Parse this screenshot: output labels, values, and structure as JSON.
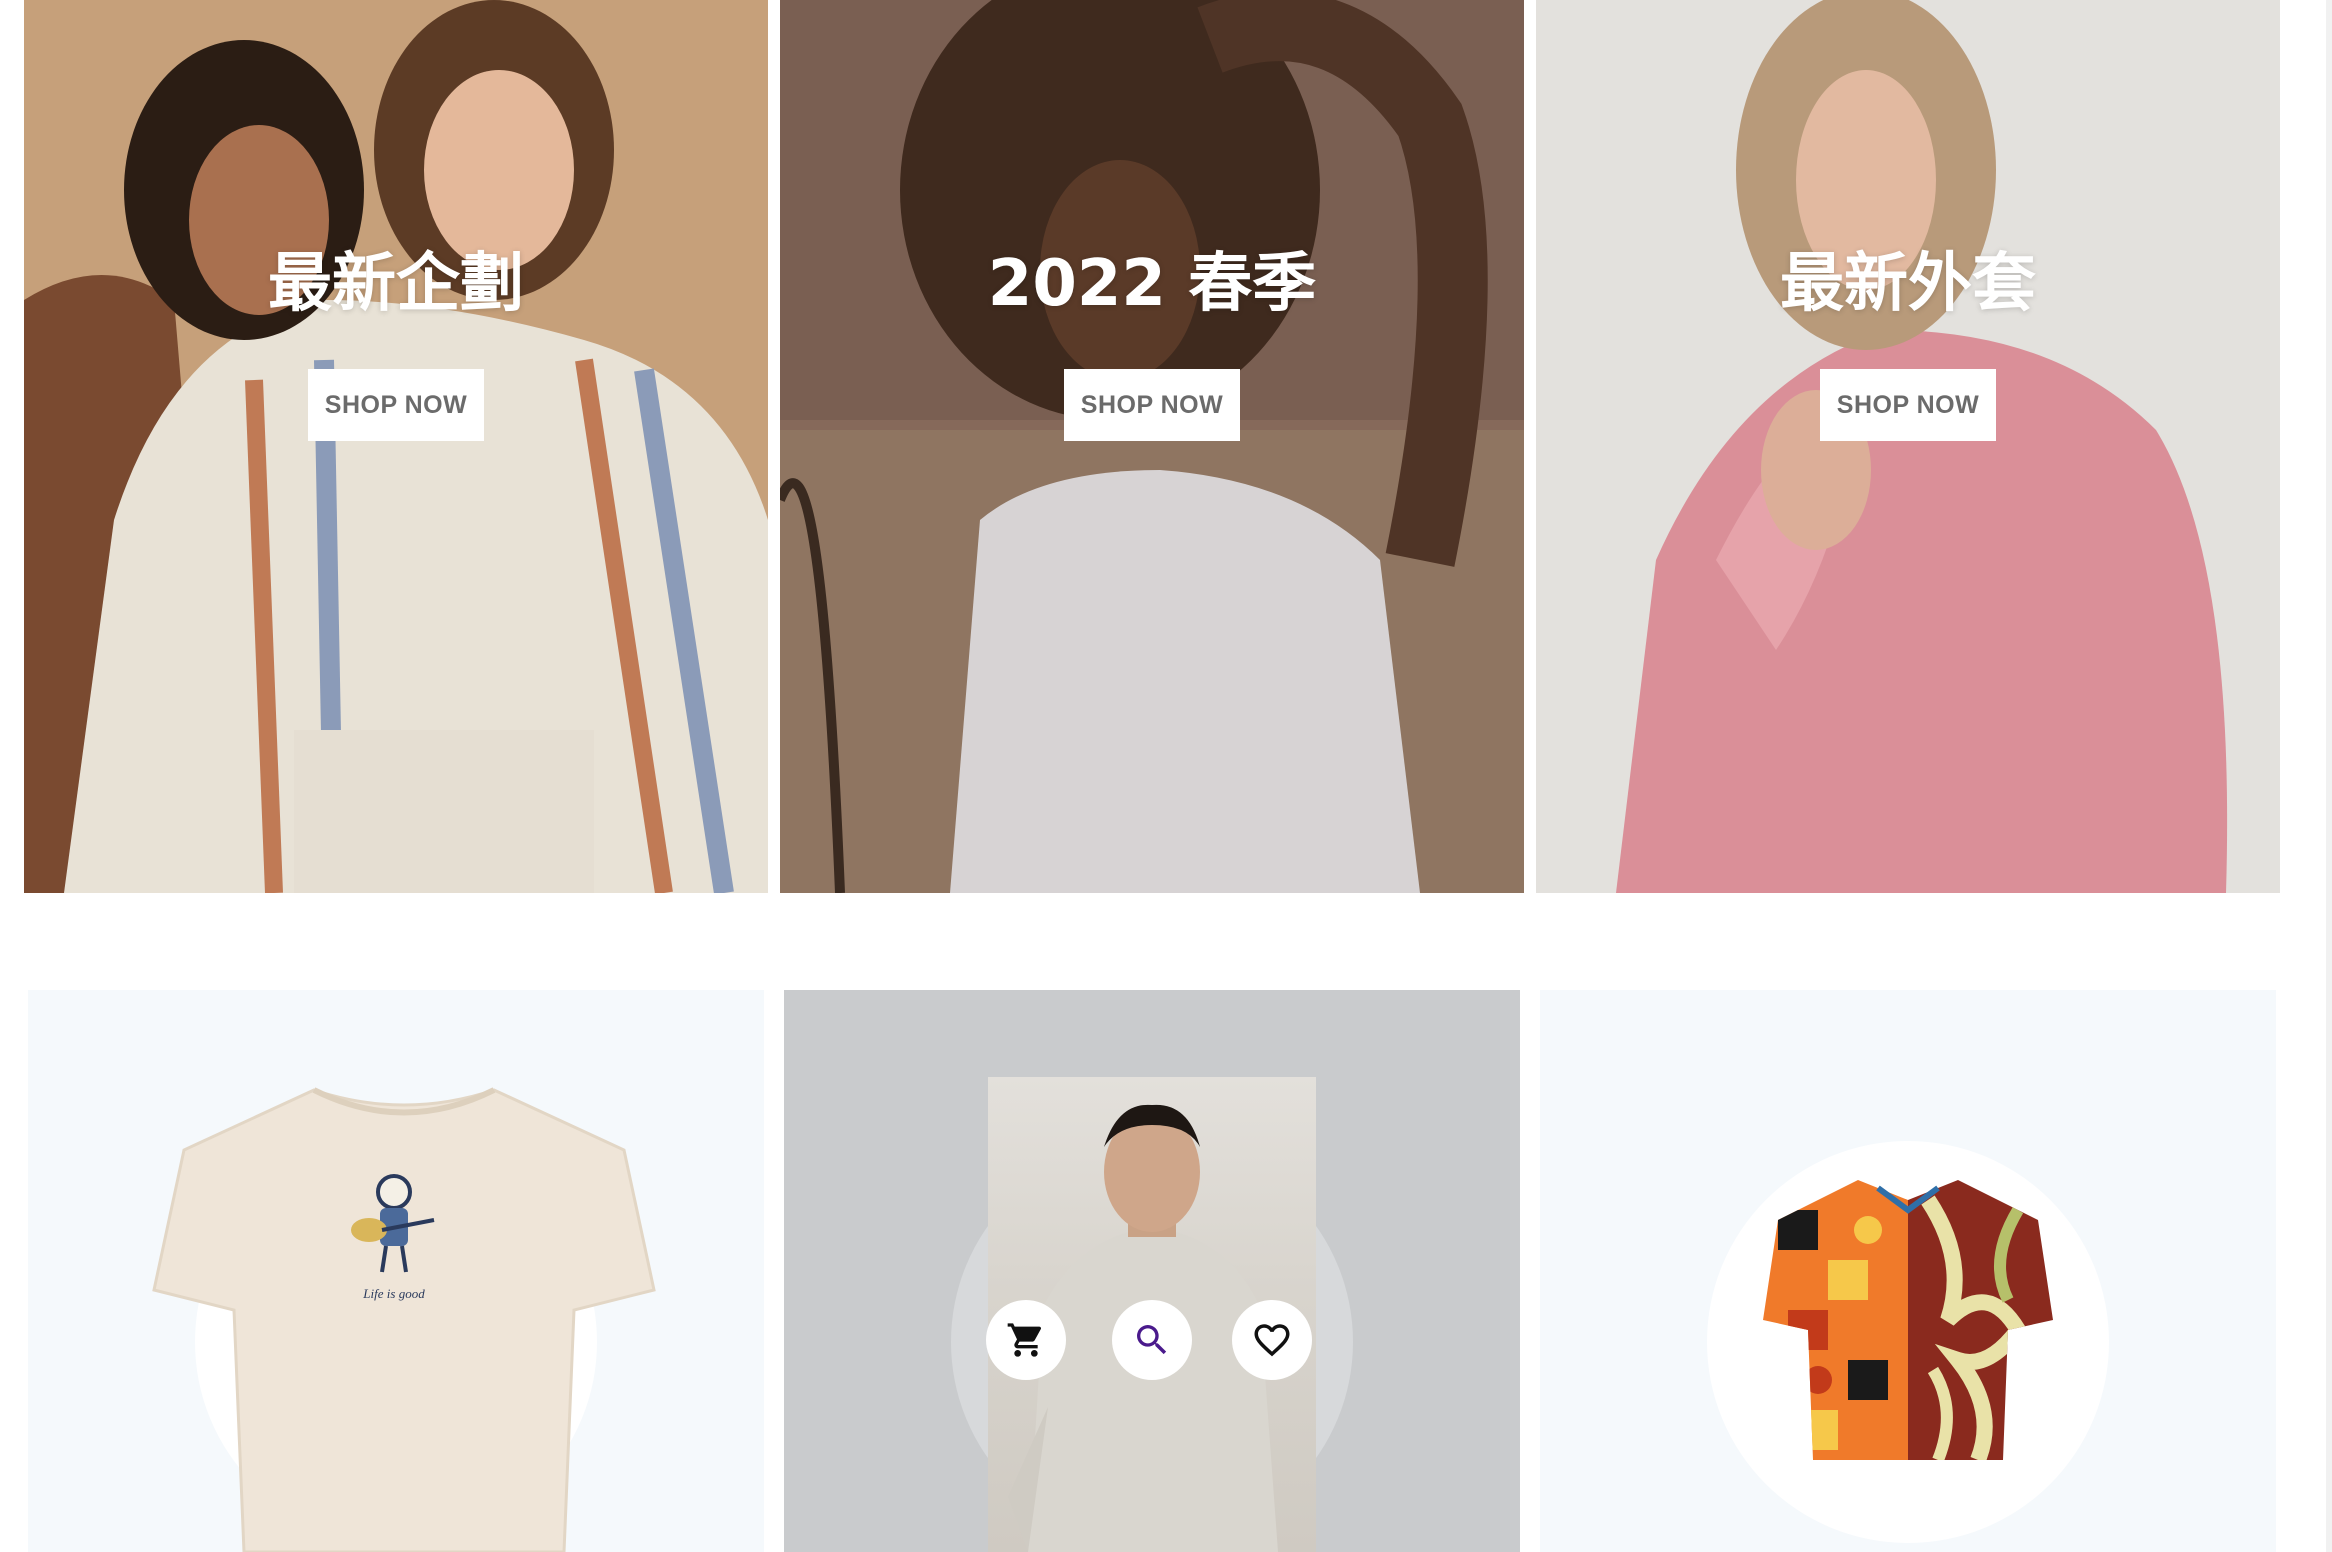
{
  "banners": [
    {
      "title": "最新企劃",
      "button_label": "SHOP NOW"
    },
    {
      "title": "2022 春季",
      "button_label": "SHOP NOW"
    },
    {
      "title": "最新外套",
      "button_label": "SHOP NOW"
    }
  ],
  "products": [
    {
      "image": "cream-graphic-tshirt",
      "print_text": "Life is good"
    },
    {
      "image": "model-grey-sweater",
      "actions": [
        "cart-icon",
        "search-icon",
        "heart-icon"
      ]
    },
    {
      "image": "patterned-short-sleeve-shirt"
    }
  ],
  "colors": {
    "accent": "#4a1a8c",
    "button_text": "#6b6b6b",
    "card_bg": "#f5f9fc"
  }
}
